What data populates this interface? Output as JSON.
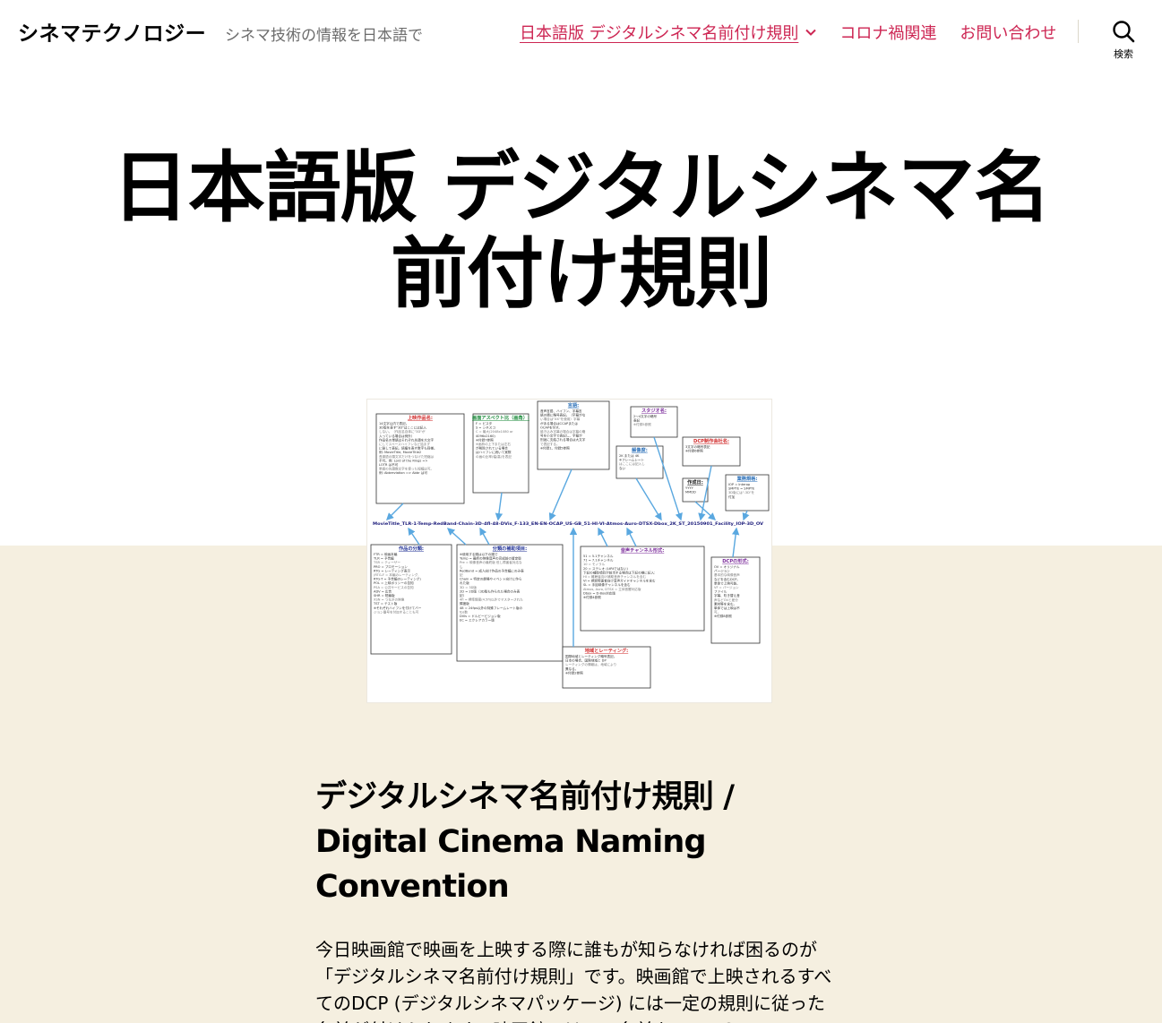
{
  "site": {
    "title": "シネマテクノロジー",
    "description": "シネマ技術の情報を日本語で"
  },
  "nav": {
    "items": [
      {
        "label": "日本語版 デジタルシネマ名前付け規則",
        "current": true,
        "has_submenu": true
      },
      {
        "label": "コロナ禍関連",
        "current": false,
        "has_submenu": false
      },
      {
        "label": "お問い合わせ",
        "current": false,
        "has_submenu": false
      }
    ],
    "search_label": "検索"
  },
  "page": {
    "title": "日本語版 デジタルシネマ名前付け規則"
  },
  "figure": {
    "filename_line": "MovieTitle_TLR-1-Temp-RedBand-Chain-3D-4fl-48-DVis_F-133_EN-EN-OCAP_US-GB_51-HI-VI-Atmos-Auro-DTSX-Dbox_2K_ST_20150901_Facility_IOP-3D_OV",
    "boxes_top": [
      {
        "title": "上映作品名:",
        "lines": [
          "14文字以内で表記。",
          "3D版を表す\"3D\"はここには記入",
          "しない。（作品名自体に\"3D\"が",
          "入っている場合は例外）",
          "作品名の単語はそれぞれ先頭を大文字",
          "にしてスペースハイフンなど詰まず",
          "に製して表記。続編を表す数字も同様。",
          "例: MovieTitle, MovieTitle2",
          "長単語の頭文字だけをつなげた短縮は",
          "不可。例: Lord of the Rings =>",
          "LOTR は不可",
          "単語の先頭数文字を使った短縮は可。",
          "例: Abbreviation => Abbr は可"
        ]
      },
      {
        "title": "画面アスペクト比（画角）:",
        "lines": [
          "F = ビスタ",
          "S = シネスコ",
          "C = 最大(2048x1080 or",
          "4096x2160)",
          "※付録7参照",
          "※画枠の上下または左右",
          "が削除されている場合",
          "はハイフンに続いて実際",
          "の画の比率(幅/高)を表記"
        ]
      },
      {
        "title": "言語:",
        "lines": [
          "音声言語、ハイフン、字幕言",
          "語の順に略号表記。（字幕がな",
          "い場合は\"XX\"を使用）字幕",
          "がある場合はCCAPまたは",
          "OCAPを付す。",
          "焼き込み字幕の場合は字幕の略",
          "号を小文字で表記し、字幕が",
          "別途に支給される場合は大文字",
          "で表記する。",
          "※付録1、付録5参照"
        ]
      },
      {
        "title": "スタジオ名:",
        "lines": [
          "2〜4文字の略号",
          "表記",
          "※付録5参照"
        ]
      },
      {
        "title": "解像度:",
        "lines": [
          "2K または 4K",
          "※フレームレート",
          "はここには記入し",
          "ない"
        ]
      },
      {
        "title": "DCP制作会社名:",
        "lines": [
          "3文字の略号表記",
          "※付録6参照"
        ]
      },
      {
        "title": "作成日:",
        "lines": [
          "YYYY",
          "MMDD"
        ]
      },
      {
        "title": "業務規格:",
        "lines": [
          "IOP = Interop",
          "SMPTE = SMPTE",
          "3D版には\"-3D\"を",
          "付加"
        ]
      }
    ],
    "boxes_bottom": [
      {
        "title": "作品の分類:",
        "lines": [
          "FTR = 映画本編",
          "TLR = 予告編",
          "TSR = ティーザー",
          "PRO = プロモーション",
          "RTG = レーティング表示",
          "(RTG-F = 本編のレーティング,",
          "RTG-T = 予告編のレーティング)",
          "POL = 上映ポリシーの告知",
          "PSA = 公共サービスの告知",
          "ADV = 広告",
          "SHR = 短編版",
          "XSN = つなぎの映像",
          "TST = テスト版",
          "※それぞれハイフンを付けてバー",
          "ジョン番号を付加することも可"
        ]
      },
      {
        "title": "分類の補助項目:",
        "lines": [
          "※使用する順は以下の順で",
          "Temp = 最終の映像音声の完成前の暫定版",
          "Pre = 映像音声の最終版 但し障害者対応な",
          "し",
          "RedBand = 成人向け作品の予告編にのみ表",
          "記",
          "Chain = 特定の劇場やイベント向けに作ら",
          "れた版",
          "3D = 3D版",
          "2D = 2D版（3D版も作られた場合のみ表",
          "記）",
          "4fl = 標準輝度(4.5fl)以外でマスターされた",
          "輝度版",
          "48 = 24fps以外の特殊フレームレート版の",
          "fps数",
          "DVis = ドルビービジョン版",
          "EC = エクレアカラー版"
        ]
      },
      {
        "title": "音声チャンネル形式:",
        "lines": [
          "51 = 5.1チャンネル",
          "71 = 7.1チャンネル",
          "10 = モノラル",
          "20 = ステレオ (LtRtではない)",
          "下記の補助項目が該当する場合は下記の様に記入:",
          "HI = 難聴者向け補助音声チャンネルを含む",
          "VI = 視覚障害者向け音声ガイドチャンネルを含む",
          "SL = 手話映像チャンネルを含む",
          "Atmos, Auro, DTSX = 立体音響対応版",
          "Dbox = D-Box対応版",
          "※付録4参照"
        ]
      },
      {
        "title": "DCPの形式:",
        "lines": [
          "OV = オリジナル",
          "バージョン",
          "基本的な映像音声",
          "などを含むDCP。",
          "単体で上映可能。",
          "VF = バージョン",
          "ファイル",
          "字幕、吹き替え音",
          "声などOVと差分",
          "素材等を含む。",
          "単体では上映は不",
          "可。",
          "※付録8参照"
        ]
      },
      {
        "title": "地域とレーティング:",
        "lines": [
          "国際地域とレーティング略号表記。",
          "日本の場合、国際地域と DP",
          "レーティングの情報は、地域により",
          "異なる。",
          "※付録2参照"
        ]
      }
    ]
  },
  "content": {
    "heading": "デジタルシネマ名前付け規則 / Digital Cinema Naming Convention",
    "paragraph": "今日映画館で映画を上映する際に誰もが知らなければ困るのが「デジタルシネマ名前付け規則」です。映画館で上映されるすべてのDCP (デジタルシネマパッケージ) には一定の規則に従った名前が付けられます。映画館ではこの名前をみてDCP"
  },
  "colors": {
    "accent": "#cd2653",
    "beige": "#f5efe0",
    "muted": "#6d6d6d"
  }
}
